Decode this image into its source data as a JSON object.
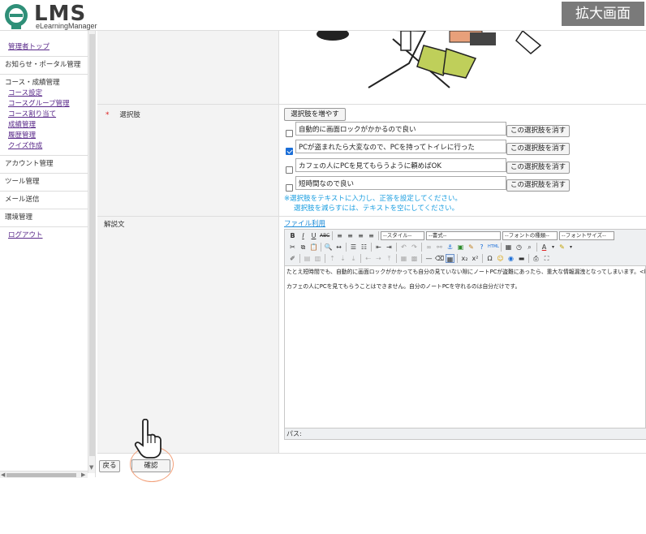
{
  "header": {
    "logo_text": "LMS",
    "logo_sub": "eLearningManager",
    "zoom_label": "拡大画面"
  },
  "sidebar": {
    "admin_top": "管理者トップ",
    "notice_portal": "お知らせ・ポータル管理",
    "course_grade_title": "コース・成績管理",
    "course_items": [
      "コース設定",
      "コースグループ管理",
      "コース割り当て",
      "成績管理",
      "履歴管理",
      "クイズ作成"
    ],
    "account": "アカウント管理",
    "tool": "ツール管理",
    "mail": "メール送信",
    "env": "環境管理",
    "logout": "ログアウト"
  },
  "form": {
    "required_mark": "*",
    "choices_label": "選択肢",
    "add_choice_button": "選択肢を増やす",
    "choices": [
      {
        "text": "自動的に画面ロックがかかるので良い",
        "checked": false
      },
      {
        "text": "PCが盗まれたら大変なので、PCを持ってトイレに行った",
        "checked": true
      },
      {
        "text": "カフェの人にPCを見てもらうように頼めばOK",
        "checked": false
      },
      {
        "text": "短時間なので良い",
        "checked": false
      }
    ],
    "delete_choice_button": "この選択肢を消す",
    "note_line1": "※選択肢をテキストに入力し、正答を設定してください。",
    "note_line2": "選択肢を減らすには、テキストを空にしてください。",
    "explanation_label": "解説文",
    "file_link": "ファイル利用",
    "toolbar": {
      "style_select": "--スタイル--",
      "format_select": "--書式--",
      "font_select": "--フォントの種類--",
      "size_select": "--フォントサイズ--"
    },
    "editor_text_line1": "たとえ短時間でも、自動的に画面ロックがかかっても自分の見ていない隙にノートPCが盗難にあったら、重大な情報漏洩となってしまいます。<br>",
    "editor_text_line2": "カフェの人にPCを見てもらうことはできません。自分のノートPCを守れるのは自分だけです。",
    "path_label": "パス:"
  },
  "footer": {
    "back_button": "戻る",
    "confirm_button": "確認"
  }
}
